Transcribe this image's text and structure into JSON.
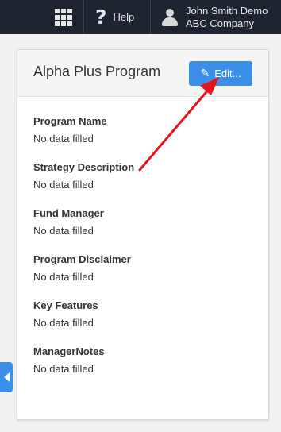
{
  "topbar": {
    "apps_icon": "grid-icon",
    "help_icon": "question-mark-icon",
    "help_label": "Help",
    "user_icon": "user-icon",
    "user_name": "John Smith Demo",
    "company": "ABC Company"
  },
  "panel": {
    "title": "Alpha Plus Program",
    "edit_label": "Edit...",
    "edit_icon": "pencil-icon",
    "fields": [
      {
        "label": "Program Name",
        "value": "No data filled"
      },
      {
        "label": "Strategy Description",
        "value": "No data filled"
      },
      {
        "label": "Fund Manager",
        "value": "No data filled"
      },
      {
        "label": "Program Disclaimer",
        "value": "No data filled"
      },
      {
        "label": "Key Features",
        "value": "No data filled"
      },
      {
        "label": "ManagerNotes",
        "value": "No data filled"
      }
    ]
  },
  "side_tab": {
    "icon": "caret-left-icon"
  },
  "colors": {
    "topbar_bg": "#1f2530",
    "accent": "#3b8fe8",
    "annotation_arrow": "#e8141c"
  }
}
